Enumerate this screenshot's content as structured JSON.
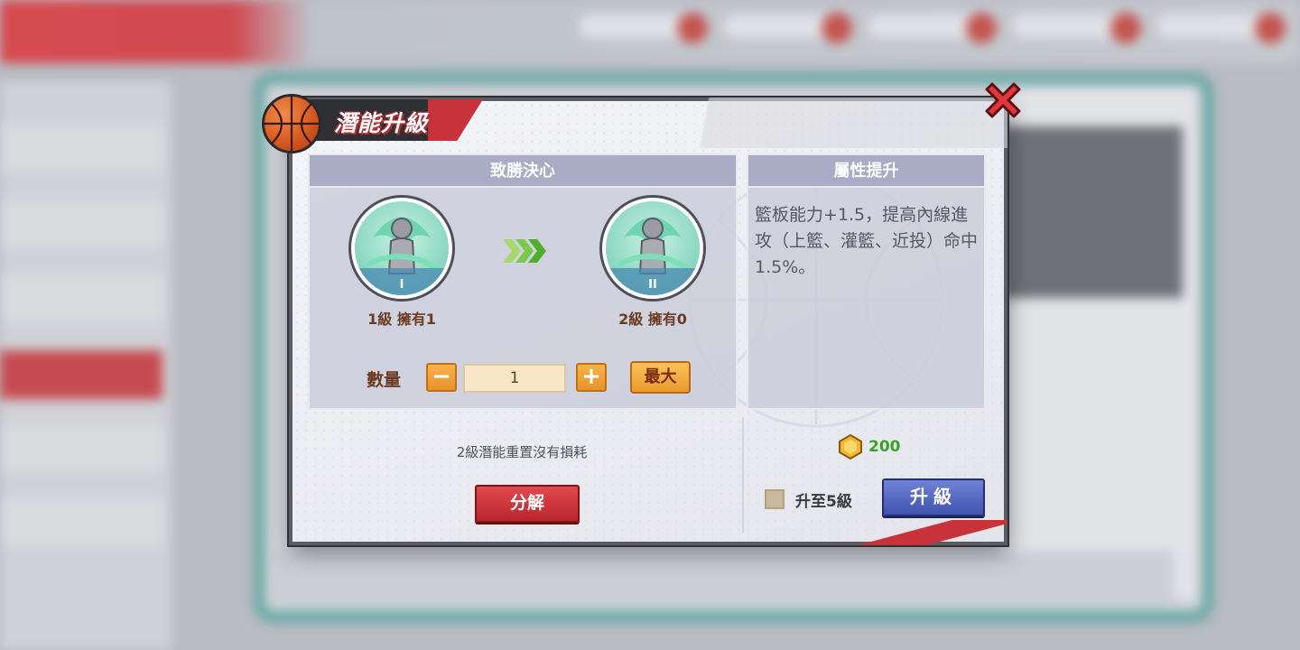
{
  "dialog": {
    "title": "潛能升級"
  },
  "left_panel": {
    "header": "致勝決心",
    "from_skill": {
      "roman": "I",
      "label": "1級 擁有1"
    },
    "to_skill": {
      "roman": "II",
      "label": "2級 擁有0"
    },
    "quantity_label": "數量",
    "minus_label": "−",
    "plus_label": "+",
    "quantity_value": "1",
    "max_label": "最大"
  },
  "right_panel": {
    "header": "屬性提升",
    "description": "籃板能力+1.5，提高內線進攻（上籃、灌籃、近投）命中1.5%。"
  },
  "footer": {
    "note": "2級潛能重置沒有損耗",
    "decompose_label": "分解",
    "cost_value": "200",
    "upgrade_to_5_label": "升至5級",
    "upgrade_label": "升級"
  },
  "colors": {
    "accent_red": "#c8323a",
    "panel_header": "#a9acc4",
    "cost_green": "#3aa32c",
    "upgrade_blue": "#3f53b0",
    "orange_button": "#eb9a2b"
  },
  "icons": {
    "title": "basketball-icon",
    "close": "close-x-icon",
    "arrow": "triple-chevron-right-icon",
    "currency": "gold-gem-icon"
  }
}
